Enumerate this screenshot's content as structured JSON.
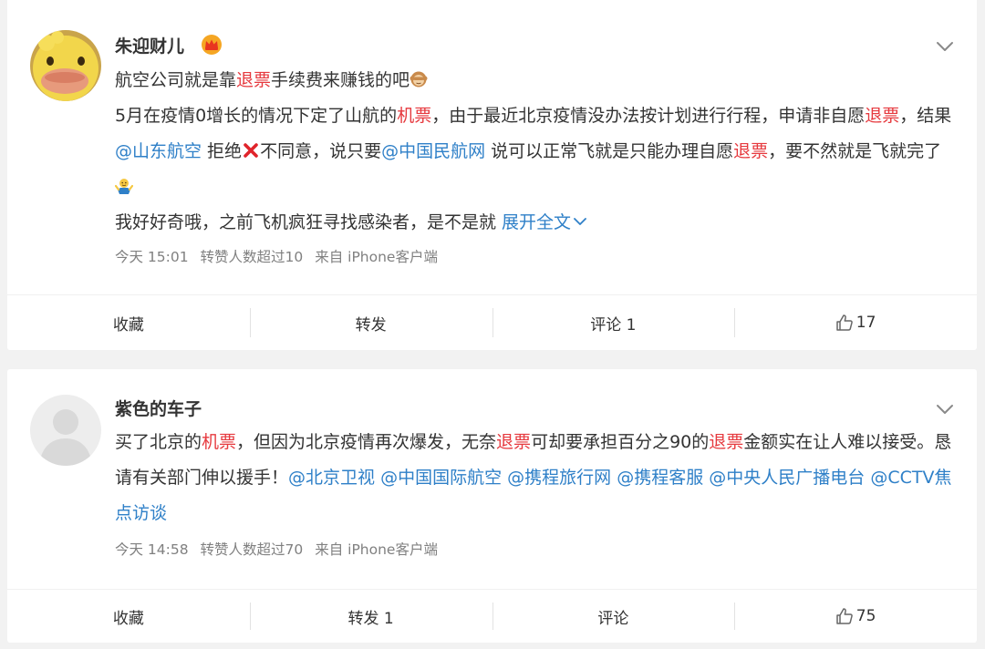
{
  "posts": [
    {
      "user": "朱迎财儿",
      "vip_badge": "crown-icon",
      "segments": [
        {
          "t": "航空公司就是靠",
          "s": "n"
        },
        {
          "t": "退票",
          "s": "h"
        },
        {
          "t": "手续费来赚钱的吧",
          "s": "n"
        },
        {
          "t": "monkey",
          "s": "icon"
        },
        {
          "t": "",
          "s": "br"
        },
        {
          "t": "5月在疫情0增长的情况下定了山航的",
          "s": "n"
        },
        {
          "t": "机票",
          "s": "h"
        },
        {
          "t": "，由于最近北京疫情没办法按计划进行行程，申请非自愿",
          "s": "n"
        },
        {
          "t": "退票",
          "s": "h"
        },
        {
          "t": "，结果",
          "s": "n"
        },
        {
          "t": "@山东航空",
          "s": "l"
        },
        {
          "t": " 拒绝",
          "s": "n"
        },
        {
          "t": "cross",
          "s": "icon"
        },
        {
          "t": "不同意，说只要",
          "s": "n"
        },
        {
          "t": "@中国民航网",
          "s": "l"
        },
        {
          "t": " 说可以正常飞就是只能办理自愿",
          "s": "n"
        },
        {
          "t": "退票",
          "s": "h"
        },
        {
          "t": "，要不然就是飞就完了",
          "s": "n"
        },
        {
          "t": "shrug",
          "s": "icon"
        },
        {
          "t": "",
          "s": "br"
        },
        {
          "t": "我好好奇哦，之前飞机疯狂寻找感染者，是不是就 ",
          "s": "n"
        },
        {
          "t": "展开全文",
          "s": "l"
        },
        {
          "t": "expand",
          "s": "icon"
        }
      ],
      "meta": {
        "time": "今天 15:01",
        "reposts": "转赞人数超过10",
        "source": "来自 iPhone客户端"
      },
      "actions": {
        "favorite": "收藏",
        "repost": "转发",
        "comment": "评论 1",
        "like": "17"
      }
    },
    {
      "user": "紫色的车子",
      "segments": [
        {
          "t": "买了北京的",
          "s": "n"
        },
        {
          "t": "机票",
          "s": "h"
        },
        {
          "t": "，但因为北京疫情再次爆发，无奈",
          "s": "n"
        },
        {
          "t": "退票",
          "s": "h"
        },
        {
          "t": "可却要承担百分之90的",
          "s": "n"
        },
        {
          "t": "退票",
          "s": "h"
        },
        {
          "t": "金额实在让人难以接受。恳请有关部门伸以援手！",
          "s": "n"
        },
        {
          "t": "@北京卫视",
          "s": "l"
        },
        {
          "t": " ",
          "s": "n"
        },
        {
          "t": "@中国国际航空",
          "s": "l"
        },
        {
          "t": " ",
          "s": "n"
        },
        {
          "t": "@携程旅行网",
          "s": "l"
        },
        {
          "t": " ",
          "s": "n"
        },
        {
          "t": "@携程客服",
          "s": "l"
        },
        {
          "t": " ",
          "s": "n"
        },
        {
          "t": "@中央人民广播电台",
          "s": "l"
        },
        {
          "t": " ",
          "s": "n"
        },
        {
          "t": "@CCTV焦点访谈",
          "s": "l"
        }
      ],
      "meta": {
        "time": "今天 14:58",
        "reposts": "转赞人数超过70",
        "source": "来自 iPhone客户端"
      },
      "actions": {
        "favorite": "收藏",
        "repost": "转发 1",
        "comment": "评论",
        "like": "75"
      }
    }
  ],
  "colors": {
    "highlight": "#e6393e",
    "link": "#2f80c8",
    "meta": "#808080",
    "background": "#f2f2f2"
  }
}
